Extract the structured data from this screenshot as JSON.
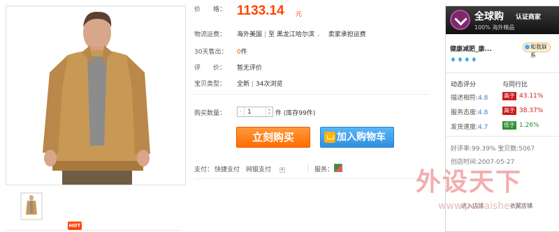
{
  "product": {
    "price_label": "价　　格：",
    "price_value": "1133.14",
    "price_unit": "元",
    "shipping_label": "物流运费：",
    "shipping_from": "海外美国",
    "shipping_to_prefix": "至",
    "shipping_to": "黑龙江哈尔滨",
    "shipping_fee": "卖家承担运费",
    "sold_label": "30天售出：",
    "sold_count": "0",
    "sold_unit": "件",
    "review_label": "评　　价：",
    "review_value": "暂无评价",
    "type_label": "宝贝类型：",
    "type_value": "全新",
    "views": "34次浏览",
    "qty_label": "购买数量：",
    "qty_value": "1",
    "qty_unit": "件",
    "stock_text": "(库存99件)",
    "buy_now": "立刻购买",
    "add_cart": "加入购物车",
    "pay_label": "支付：",
    "pay_options": "快捷支付　网银支付",
    "service_label": "服务："
  },
  "gallery": {
    "hot_badge": "HOT"
  },
  "shop": {
    "brand_title": "全球购",
    "cert_title": "认证商家",
    "brand_sub": "100% 海外精品",
    "shop_name": "健康减肥_康...",
    "contact_label": "和我联系",
    "diamonds": "♦♦♦♦",
    "dsr_title": "动态评分",
    "dsr_compare": "与同行比",
    "dsr": [
      {
        "label": "描述相符:",
        "score": "4.8",
        "badge": "高于",
        "pct": "43.11%",
        "badge_color": "#cc1a1a",
        "pct_color": "#cc1a1a"
      },
      {
        "label": "服务态度:",
        "score": "4.8",
        "badge": "高于",
        "pct": "38.37%",
        "badge_color": "#cc1a1a",
        "pct_color": "#cc1a1a"
      },
      {
        "label": "发货速度:",
        "score": "4.7",
        "badge": "低于",
        "pct": "1.26%",
        "badge_color": "#2f8f2f",
        "pct_color": "#2f8f2f"
      }
    ],
    "rating_text": "好评率:99.39%",
    "items_text": "宝贝数:5067",
    "created_text": "创店时间:2007-05-27",
    "enter_shop": "进入店铺",
    "favorite_shop": "收藏店铺"
  },
  "watermark": {
    "main": "外设天下",
    "url": "www.pcwaishe.cn"
  }
}
